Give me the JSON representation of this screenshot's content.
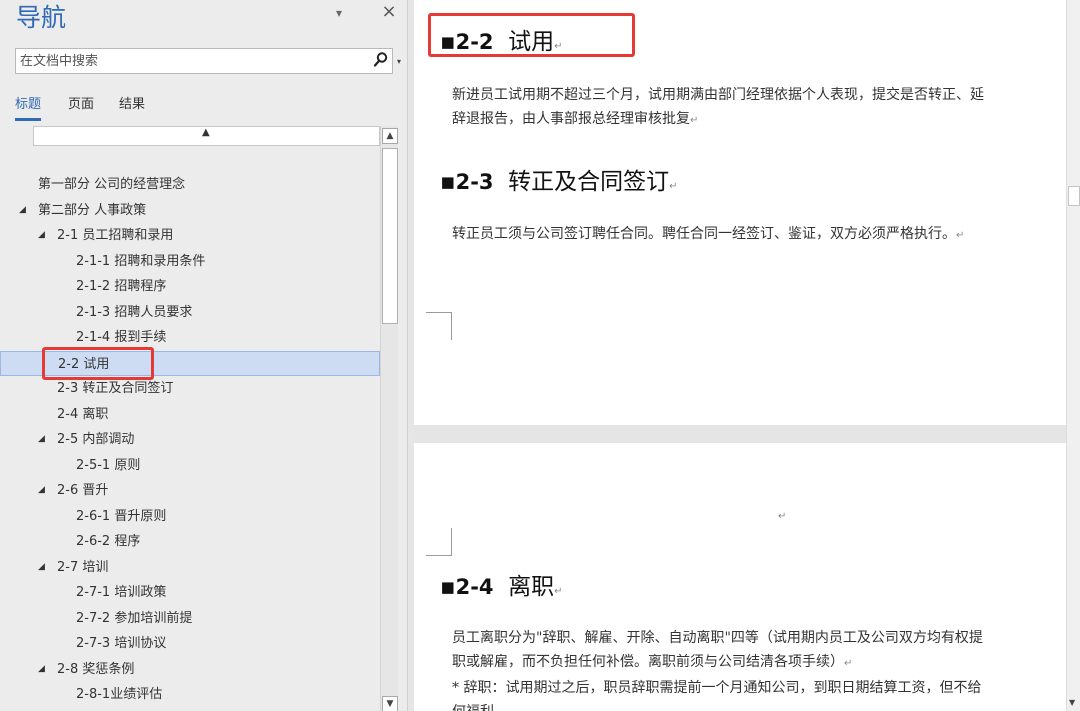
{
  "nav": {
    "title": "导航",
    "menu_glyph": "▾",
    "close_glyph": "×",
    "search": {
      "placeholder": "在文档中搜索",
      "dropdown_glyph": "▾"
    },
    "tabs": [
      {
        "label": "标题",
        "active": true
      },
      {
        "label": "页面",
        "active": false
      },
      {
        "label": "结果",
        "active": false
      }
    ],
    "collapse_glyph": "▲",
    "tree": [
      {
        "label": "第一部分 公司的经营理念",
        "level": 0,
        "expanded": null,
        "selected": false
      },
      {
        "label": "第二部分 人事政策",
        "level": 0,
        "expanded": true,
        "selected": false
      },
      {
        "label": "2-1 员工招聘和录用",
        "level": 1,
        "expanded": true,
        "selected": false
      },
      {
        "label": "2-1-1 招聘和录用条件",
        "level": 2,
        "expanded": null,
        "selected": false
      },
      {
        "label": "2-1-2 招聘程序",
        "level": 2,
        "expanded": null,
        "selected": false
      },
      {
        "label": "2-1-3 招聘人员要求",
        "level": 2,
        "expanded": null,
        "selected": false
      },
      {
        "label": "2-1-4 报到手续",
        "level": 2,
        "expanded": null,
        "selected": false
      },
      {
        "label": "2-2 试用",
        "level": 1,
        "expanded": null,
        "selected": true
      },
      {
        "label": "2-3 转正及合同签订",
        "level": 1,
        "expanded": null,
        "selected": false
      },
      {
        "label": "2-4 离职",
        "level": 1,
        "expanded": null,
        "selected": false
      },
      {
        "label": "2-5 内部调动",
        "level": 1,
        "expanded": true,
        "selected": false
      },
      {
        "label": "2-5-1 原则",
        "level": 2,
        "expanded": null,
        "selected": false
      },
      {
        "label": "2-6 晋升",
        "level": 1,
        "expanded": true,
        "selected": false
      },
      {
        "label": "2-6-1 晋升原则",
        "level": 2,
        "expanded": null,
        "selected": false
      },
      {
        "label": "2-6-2 程序",
        "level": 2,
        "expanded": null,
        "selected": false
      },
      {
        "label": "2-7 培训",
        "level": 1,
        "expanded": true,
        "selected": false
      },
      {
        "label": "2-7-1 培训政策",
        "level": 2,
        "expanded": null,
        "selected": false
      },
      {
        "label": "2-7-2 参加培训前提",
        "level": 2,
        "expanded": null,
        "selected": false
      },
      {
        "label": "2-7-3 培训协议",
        "level": 2,
        "expanded": null,
        "selected": false
      },
      {
        "label": "2-8 奖惩条例",
        "level": 1,
        "expanded": true,
        "selected": false
      },
      {
        "label": "2-8-1业绩评估",
        "level": 2,
        "expanded": null,
        "selected": false
      }
    ]
  },
  "doc": {
    "bullet": "▪",
    "para_mark": "↵",
    "sec22": {
      "num": "2-2",
      "title": "试用"
    },
    "p22_line1": "新进员工试用期不超过三个月，试用期满由部门经理依据个人表现，提交是否转正、延",
    "p22_line2": "辞退报告，由人事部报总经理审核批复",
    "sec23": {
      "num": "2-3",
      "title": "转正及合同签订"
    },
    "p23_line1": "转正员工须与公司签订聘任合同。聘任合同一经签订、鉴证，双方必须严格执行。",
    "sec24": {
      "num": "2-4",
      "title": "离职"
    },
    "p24_line1": "员工离职分为\"辞职、解雇、开除、自动离职\"四等（试用期内员工及公司双方均有权提",
    "p24_line2": "职或解雇，而不负担任何补偿。离职前须与公司结清各项手续）",
    "p24_line3": "* 辞职：试用期过之后，职员辞职需提前一个月通知公司，到职日期结算工资，但不给",
    "p24_line4": "何福利"
  },
  "colors": {
    "accent": "#2f6ab5",
    "highlight_box": "#e53935",
    "selected_bg": "#cddcf3"
  }
}
